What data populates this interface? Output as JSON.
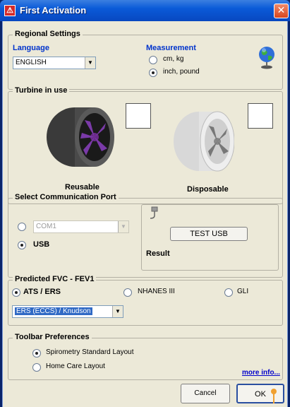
{
  "window": {
    "title": "First Activation",
    "app_icon_glyph": "⚠",
    "close_glyph": "✕"
  },
  "regional": {
    "legend": "Regional Settings",
    "language_label": "Language",
    "language_value": "ENGLISH",
    "measurement_label": "Measurement",
    "options": [
      "cm, kg",
      "inch, pound"
    ],
    "selected_option": "inch, pound",
    "icon": "globe-icon"
  },
  "turbine": {
    "legend": "Turbine in use",
    "reusable_label": "Reusable",
    "disposable_label": "Disposable"
  },
  "comm": {
    "legend": "Select Communication Port",
    "com_value": "COM1",
    "usb_label": "USB",
    "test_usb_label": "TEST USB",
    "result_label": "Result",
    "icon": "usb-plug-icon"
  },
  "predicted": {
    "legend": "Predicted FVC - FEV1",
    "options": [
      "ATS / ERS",
      "NHANES III",
      "GLI"
    ],
    "selected_option": "ATS / ERS",
    "combo_value": "ERS (ECCS) / Knudson"
  },
  "toolbar": {
    "legend": "Toolbar Preferences",
    "options": [
      "Spirometry Standard Layout",
      "Home Care Layout"
    ],
    "selected_option": "Spirometry Standard Layout",
    "more_info": "more info..."
  },
  "buttons": {
    "cancel": "Cancel",
    "ok": "OK"
  },
  "colors": {
    "title_blue": "#0a5ad8",
    "accent_blue": "#0033cc",
    "selection": "#316ac5",
    "cursor_orange": "#f0a030"
  }
}
